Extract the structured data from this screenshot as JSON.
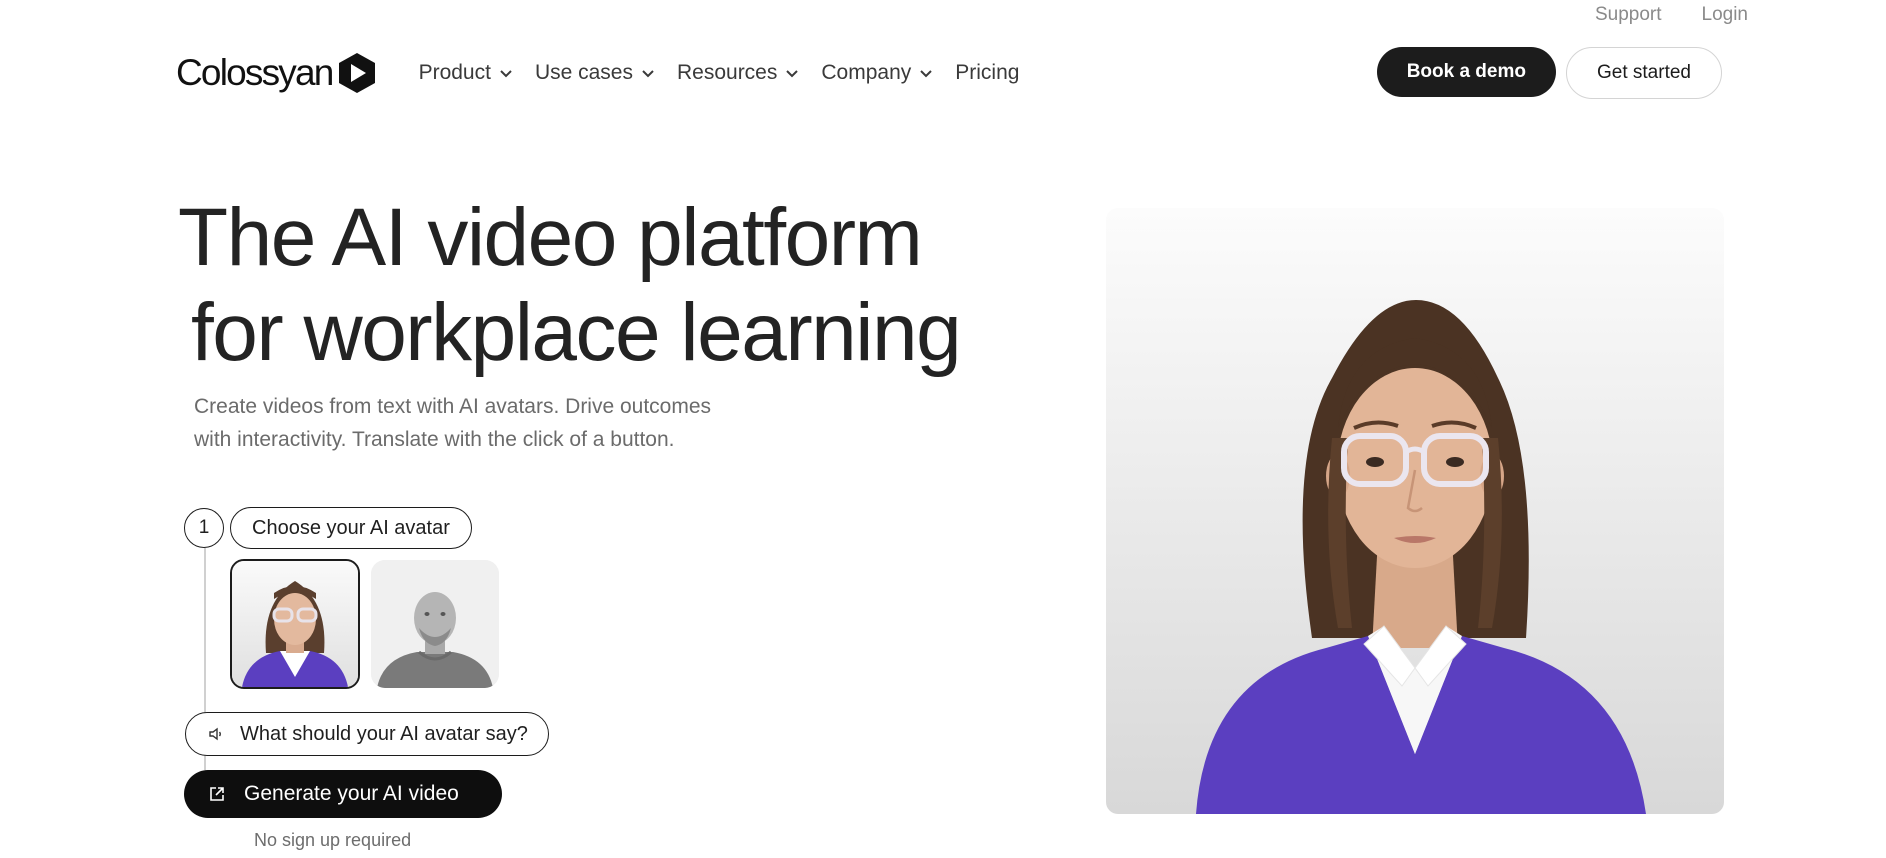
{
  "util_nav": {
    "support": "Support",
    "login": "Login"
  },
  "brand": {
    "name": "Colossyan"
  },
  "nav": {
    "items": [
      {
        "label": "Product",
        "has_dropdown": true
      },
      {
        "label": "Use cases",
        "has_dropdown": true
      },
      {
        "label": "Resources",
        "has_dropdown": true
      },
      {
        "label": "Company",
        "has_dropdown": true
      },
      {
        "label": "Pricing",
        "has_dropdown": false
      }
    ],
    "book_demo": "Book a demo",
    "get_started": "Get started"
  },
  "hero": {
    "title_line1": "The AI video platform",
    "title_line2": "for workplace learning",
    "subtitle_line1": "Create videos from text with AI avatars. Drive outcomes",
    "subtitle_line2": "with interactivity. Translate with the click of a button."
  },
  "steps": {
    "step_number": "1",
    "choose_avatar": "Choose your AI avatar",
    "say_prompt": "What should your AI avatar say?",
    "generate": "Generate your AI video",
    "no_signup": "No sign up required"
  },
  "icons": {
    "logo": "play-hexagon-icon",
    "dropdown": "chevron-down-icon",
    "speaker": "speaker-icon",
    "generate": "external-link-icon"
  },
  "colors": {
    "primary_dark": "#1c1c1c",
    "sweater_purple": "#5b3fc0",
    "muted_text": "#6b6b6b"
  }
}
